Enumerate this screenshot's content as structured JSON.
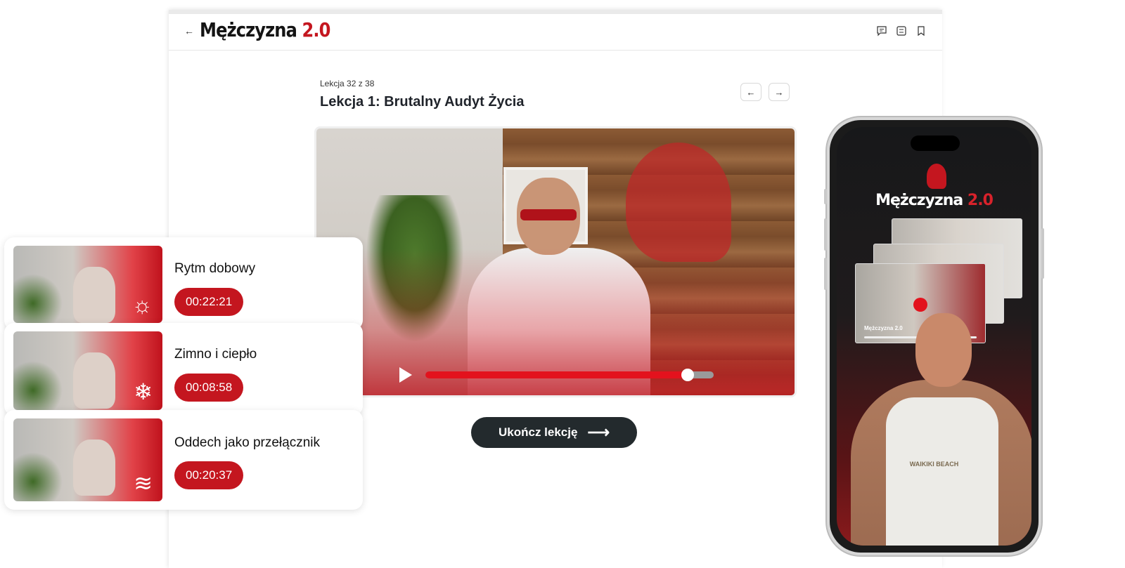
{
  "app": {
    "logo_main": "Mężczyzna",
    "logo_accent": "2.0"
  },
  "topbar": {
    "back_icon": "arrow-left-icon",
    "icons": [
      "chat-icon",
      "list-icon",
      "bookmark-icon"
    ]
  },
  "lesson": {
    "counter": "Lekcja 32 z 38",
    "title": "Lekcja 1: Brutalny Audyt Życia",
    "prev_icon": "←",
    "next_icon": "→",
    "finish_label": "Ukończ lekcję",
    "finish_arrow": "⟶"
  },
  "video": {
    "progress": 0.91
  },
  "lessons_list": [
    {
      "title": "Rytm dobowy",
      "duration": "00:22:21",
      "icon": "☼",
      "icon_name": "sun-icon"
    },
    {
      "title": "Zimno i ciepło",
      "duration": "00:08:58",
      "icon": "❄",
      "icon_name": "snowflake-icon"
    },
    {
      "title": "Oddech jako przełącznik",
      "duration": "00:20:37",
      "icon": "≋",
      "icon_name": "wind-icon"
    }
  ],
  "phone": {
    "logo_main": "Mężczyzna",
    "logo_accent": "2.0",
    "mini_title": "Mężczyzna 2.0",
    "shirt_text": "WAIKIKI BEACH"
  },
  "colors": {
    "accent": "#c4161f",
    "dark_button": "#232a2d"
  }
}
